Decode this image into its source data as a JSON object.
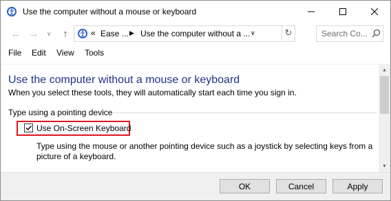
{
  "window": {
    "title": "Use the computer without a mouse or keyboard",
    "icon": "control-panel-ease-of-access-icon"
  },
  "address": {
    "chevrons": "«",
    "segments": [
      "Ease ...",
      "Use the computer without a ..."
    ],
    "refresh_icon": "refresh-icon"
  },
  "search": {
    "placeholder": "Search Co..."
  },
  "menu": {
    "items": [
      "File",
      "Edit",
      "View",
      "Tools"
    ]
  },
  "content": {
    "title": "Use the computer without a mouse or keyboard",
    "subtitle": "When you select these tools, they will automatically start each time you sign in.",
    "section_label": "Type using a pointing device",
    "option": {
      "label": "Use On-Screen Keyboard",
      "checked": true
    },
    "description": "Type using the mouse or another pointing device such as a joystick by selecting keys from a picture of a keyboard."
  },
  "buttons": {
    "ok": "OK",
    "cancel": "Cancel",
    "apply": "Apply"
  },
  "colors": {
    "title_blue": "#1e3287",
    "highlight_red": "#e0141e"
  }
}
